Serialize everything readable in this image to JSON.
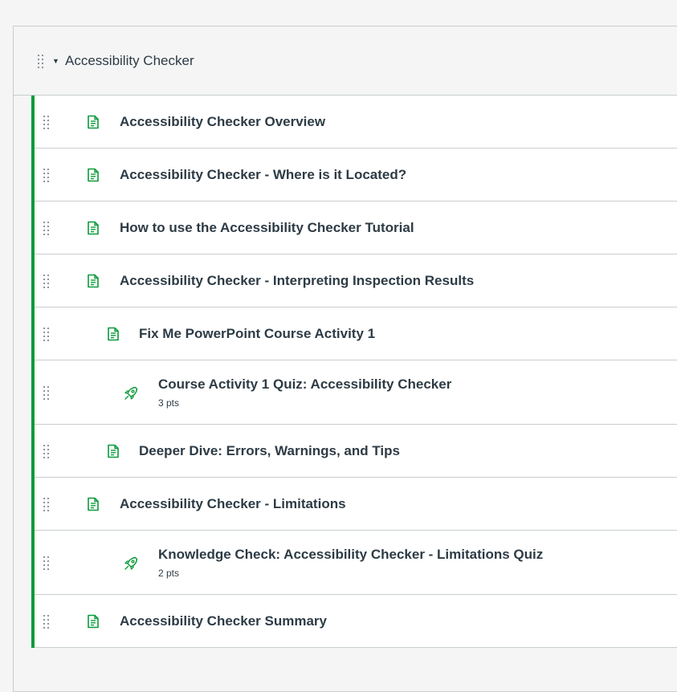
{
  "module": {
    "title": "Accessibility Checker",
    "accent_color": "#0b9b3a"
  },
  "items": [
    {
      "title": "Accessibility Checker Overview",
      "type": "page-icon",
      "indent": 0
    },
    {
      "title": "Accessibility Checker - Where is it Located?",
      "type": "page-icon",
      "indent": 0
    },
    {
      "title": "How to use the Accessibility Checker Tutorial",
      "type": "page-icon",
      "indent": 0
    },
    {
      "title": "Accessibility Checker - Interpreting Inspection Results",
      "type": "page-icon",
      "indent": 0
    },
    {
      "title": "Fix Me PowerPoint Course Activity 1",
      "type": "page-icon",
      "indent": 1
    },
    {
      "title": "Course Activity 1 Quiz: Accessibility Checker",
      "points": "3 pts",
      "type": "quiz-rocket-icon",
      "indent": 2
    },
    {
      "title": "Deeper Dive: Errors, Warnings, and Tips",
      "type": "page-icon",
      "indent": 1
    },
    {
      "title": "Accessibility Checker - Limitations",
      "type": "page-icon",
      "indent": 0
    },
    {
      "title": "Knowledge Check: Accessibility Checker - Limitations Quiz",
      "points": "2 pts",
      "type": "quiz-rocket-icon",
      "indent": 2
    },
    {
      "title": "Accessibility Checker Summary",
      "type": "page-icon",
      "indent": 0
    }
  ]
}
